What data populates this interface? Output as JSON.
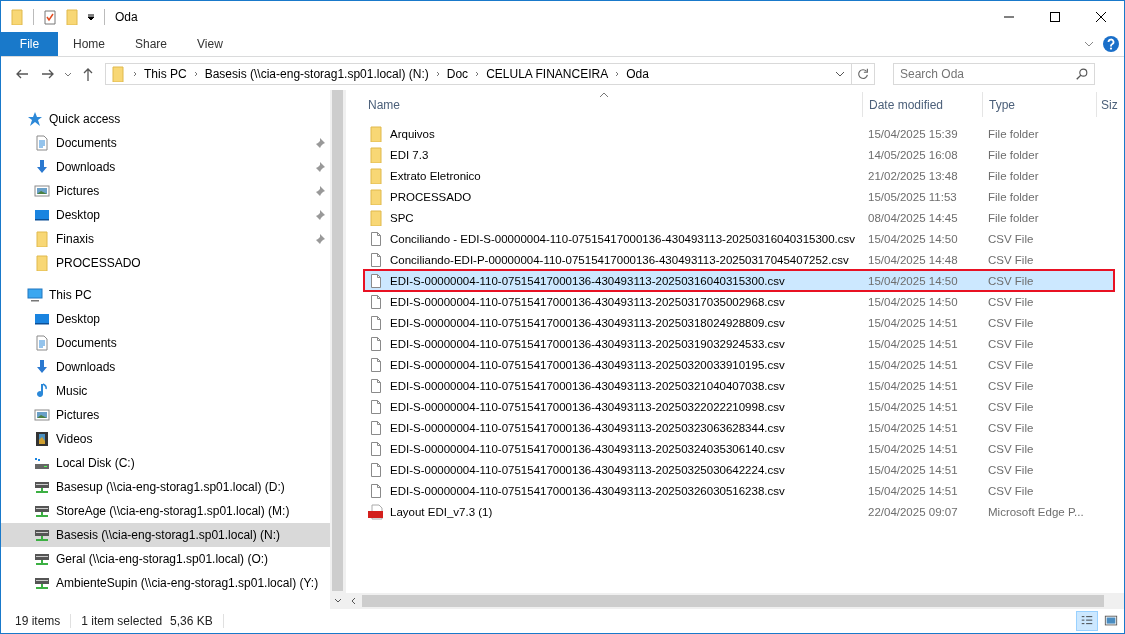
{
  "window": {
    "title": "Oda"
  },
  "ribbon": {
    "tabs": [
      {
        "label": "File",
        "kind": "file"
      },
      {
        "label": "Home",
        "kind": "tab"
      },
      {
        "label": "Share",
        "kind": "tab"
      },
      {
        "label": "View",
        "kind": "tab"
      }
    ],
    "expanded": false
  },
  "address": {
    "path": [
      "This PC",
      "Basesis (\\\\cia-eng-storag1.sp01.local) (N:)",
      "Doc",
      "CELULA FINANCEIRA",
      "Oda"
    ],
    "search_placeholder": "Search Oda"
  },
  "navigation": [
    {
      "label": "Quick access",
      "kind": "star",
      "children": [
        {
          "label": "Documents",
          "kind": "documents",
          "pinned": true,
          "selected": false
        },
        {
          "label": "Downloads",
          "kind": "downloads",
          "pinned": true,
          "selected": false
        },
        {
          "label": "Pictures",
          "kind": "pictures",
          "pinned": true,
          "selected": false
        },
        {
          "label": "Desktop",
          "kind": "desktop",
          "pinned": true,
          "selected": false
        },
        {
          "label": "Finaxis",
          "kind": "folder",
          "pinned": true,
          "selected": false
        },
        {
          "label": "PROCESSADO",
          "kind": "folder",
          "pinned": false,
          "selected": false
        }
      ]
    },
    {
      "label": "This PC",
      "kind": "pc",
      "children": [
        {
          "label": "Desktop",
          "kind": "desktop",
          "pinned": false,
          "selected": false
        },
        {
          "label": "Documents",
          "kind": "documents",
          "pinned": false,
          "selected": false
        },
        {
          "label": "Downloads",
          "kind": "downloads",
          "pinned": false,
          "selected": false
        },
        {
          "label": "Music",
          "kind": "music",
          "pinned": false,
          "selected": false
        },
        {
          "label": "Pictures",
          "kind": "pictures",
          "pinned": false,
          "selected": false
        },
        {
          "label": "Videos",
          "kind": "videos",
          "pinned": false,
          "selected": false
        },
        {
          "label": "Local Disk (C:)",
          "kind": "disk",
          "pinned": false,
          "selected": false
        },
        {
          "label": "Basesup (\\\\cia-eng-storag1.sp01.local) (D:)",
          "kind": "netdrive",
          "pinned": false,
          "selected": false
        },
        {
          "label": "StoreAge (\\\\cia-eng-storag1.sp01.local) (M:)",
          "kind": "netdrive",
          "pinned": false,
          "selected": false
        },
        {
          "label": "Basesis (\\\\cia-eng-storag1.sp01.local) (N:)",
          "kind": "netdrive",
          "pinned": false,
          "selected": true
        },
        {
          "label": "Geral (\\\\cia-eng-storag1.sp01.local) (O:)",
          "kind": "netdrive",
          "pinned": false,
          "selected": false
        },
        {
          "label": "AmbienteSupin (\\\\cia-eng-storag1.sp01.local) (Y:)",
          "kind": "netdrive",
          "pinned": false,
          "selected": false
        }
      ]
    }
  ],
  "columns": [
    {
      "label": "Name",
      "sorted": true
    },
    {
      "label": "Date modified",
      "sorted": false
    },
    {
      "label": "Type",
      "sorted": false
    },
    {
      "label": "Siz",
      "sorted": false
    }
  ],
  "rows": [
    {
      "name": "Arquivos",
      "date": "15/04/2025 15:39",
      "type": "File folder",
      "kind": "folder",
      "selected": false,
      "outlined": false
    },
    {
      "name": "EDI 7.3",
      "date": "14/05/2025 16:08",
      "type": "File folder",
      "kind": "folder",
      "selected": false,
      "outlined": false
    },
    {
      "name": "Extrato Eletronico",
      "date": "21/02/2025 13:48",
      "type": "File folder",
      "kind": "folder",
      "selected": false,
      "outlined": false
    },
    {
      "name": "PROCESSADO",
      "date": "15/05/2025 11:53",
      "type": "File folder",
      "kind": "folder",
      "selected": false,
      "outlined": false
    },
    {
      "name": "SPC",
      "date": "08/04/2025 14:45",
      "type": "File folder",
      "kind": "folder",
      "selected": false,
      "outlined": false
    },
    {
      "name": "Conciliando - EDI-S-00000004-110-07515417000136-430493113-20250316040315300.csv",
      "date": "15/04/2025 14:50",
      "type": "CSV File",
      "kind": "csv",
      "selected": false,
      "outlined": false
    },
    {
      "name": "Conciliando-EDI-P-00000004-110-07515417000136-430493113-20250317045407252.csv",
      "date": "15/04/2025 14:48",
      "type": "CSV File",
      "kind": "csv",
      "selected": false,
      "outlined": false
    },
    {
      "name": "EDI-S-00000004-110-07515417000136-430493113-20250316040315300.csv",
      "date": "15/04/2025 14:50",
      "type": "CSV File",
      "kind": "csv",
      "selected": true,
      "outlined": true
    },
    {
      "name": "EDI-S-00000004-110-07515417000136-430493113-20250317035002968.csv",
      "date": "15/04/2025 14:50",
      "type": "CSV File",
      "kind": "csv",
      "selected": false,
      "outlined": false
    },
    {
      "name": "EDI-S-00000004-110-07515417000136-430493113-20250318024928809.csv",
      "date": "15/04/2025 14:51",
      "type": "CSV File",
      "kind": "csv",
      "selected": false,
      "outlined": false
    },
    {
      "name": "EDI-S-00000004-110-07515417000136-430493113-20250319032924533.csv",
      "date": "15/04/2025 14:51",
      "type": "CSV File",
      "kind": "csv",
      "selected": false,
      "outlined": false
    },
    {
      "name": "EDI-S-00000004-110-07515417000136-430493113-20250320033910195.csv",
      "date": "15/04/2025 14:51",
      "type": "CSV File",
      "kind": "csv",
      "selected": false,
      "outlined": false
    },
    {
      "name": "EDI-S-00000004-110-07515417000136-430493113-20250321040407038.csv",
      "date": "15/04/2025 14:51",
      "type": "CSV File",
      "kind": "csv",
      "selected": false,
      "outlined": false
    },
    {
      "name": "EDI-S-00000004-110-07515417000136-430493113-20250322022210998.csv",
      "date": "15/04/2025 14:51",
      "type": "CSV File",
      "kind": "csv",
      "selected": false,
      "outlined": false
    },
    {
      "name": "EDI-S-00000004-110-07515417000136-430493113-20250323063628344.csv",
      "date": "15/04/2025 14:51",
      "type": "CSV File",
      "kind": "csv",
      "selected": false,
      "outlined": false
    },
    {
      "name": "EDI-S-00000004-110-07515417000136-430493113-20250324035306140.csv",
      "date": "15/04/2025 14:51",
      "type": "CSV File",
      "kind": "csv",
      "selected": false,
      "outlined": false
    },
    {
      "name": "EDI-S-00000004-110-07515417000136-430493113-20250325030642224.csv",
      "date": "15/04/2025 14:51",
      "type": "CSV File",
      "kind": "csv",
      "selected": false,
      "outlined": false
    },
    {
      "name": "EDI-S-00000004-110-07515417000136-430493113-20250326030516238.csv",
      "date": "15/04/2025 14:51",
      "type": "CSV File",
      "kind": "csv",
      "selected": false,
      "outlined": false
    },
    {
      "name": "Layout EDI_v7.3 (1)",
      "date": "22/04/2025 09:07",
      "type": "Microsoft Edge P...",
      "kind": "pdf",
      "selected": false,
      "outlined": false
    }
  ],
  "status_bar": {
    "item_count": "19 items",
    "selection": "1 item selected",
    "size": "5,36 KB",
    "views": [
      {
        "kind": "details",
        "selected": true
      },
      {
        "kind": "thumbnails",
        "selected": false
      }
    ]
  }
}
